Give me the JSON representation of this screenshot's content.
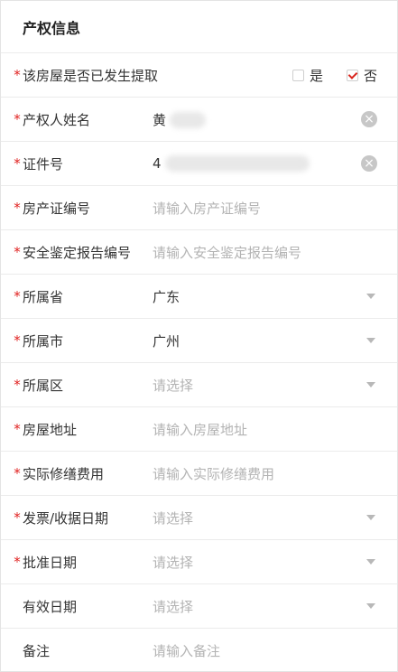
{
  "section": {
    "title": "产权信息"
  },
  "required_mark": "*",
  "extraction": {
    "label": "该房屋是否已发生提取",
    "options": [
      {
        "label": "是",
        "checked": false
      },
      {
        "label": "否",
        "checked": true
      }
    ]
  },
  "fields": {
    "owner_name": {
      "label": "产权人姓名",
      "value": "黄"
    },
    "id_number": {
      "label": "证件号",
      "value": "4"
    },
    "property_cert": {
      "label": "房产证编号",
      "placeholder": "请输入房产证编号"
    },
    "safety_report": {
      "label": "安全鉴定报告编号",
      "placeholder": "请输入安全鉴定报告编号"
    },
    "province": {
      "label": "所属省",
      "value": "广东"
    },
    "city": {
      "label": "所属市",
      "value": "广州"
    },
    "district": {
      "label": "所属区",
      "placeholder": "请选择"
    },
    "address": {
      "label": "房屋地址",
      "placeholder": "请输入房屋地址"
    },
    "repair_cost": {
      "label": "实际修缮费用",
      "placeholder": "请输入实际修缮费用"
    },
    "invoice_date": {
      "label": "发票/收据日期",
      "placeholder": "请选择"
    },
    "approval_date": {
      "label": "批准日期",
      "placeholder": "请选择"
    },
    "valid_date": {
      "label": "有效日期",
      "placeholder": "请选择"
    },
    "remark": {
      "label": "备注",
      "placeholder": "请输入备注"
    }
  },
  "icons": {
    "clear": "clear-circle-icon",
    "dropdown": "caret-down-icon",
    "checkbox_checked": "checkmark-icon"
  },
  "colors": {
    "required": "#e0201f",
    "check": "#d9251d",
    "placeholder": "#b3b3b3",
    "divider": "#ebebeb"
  }
}
